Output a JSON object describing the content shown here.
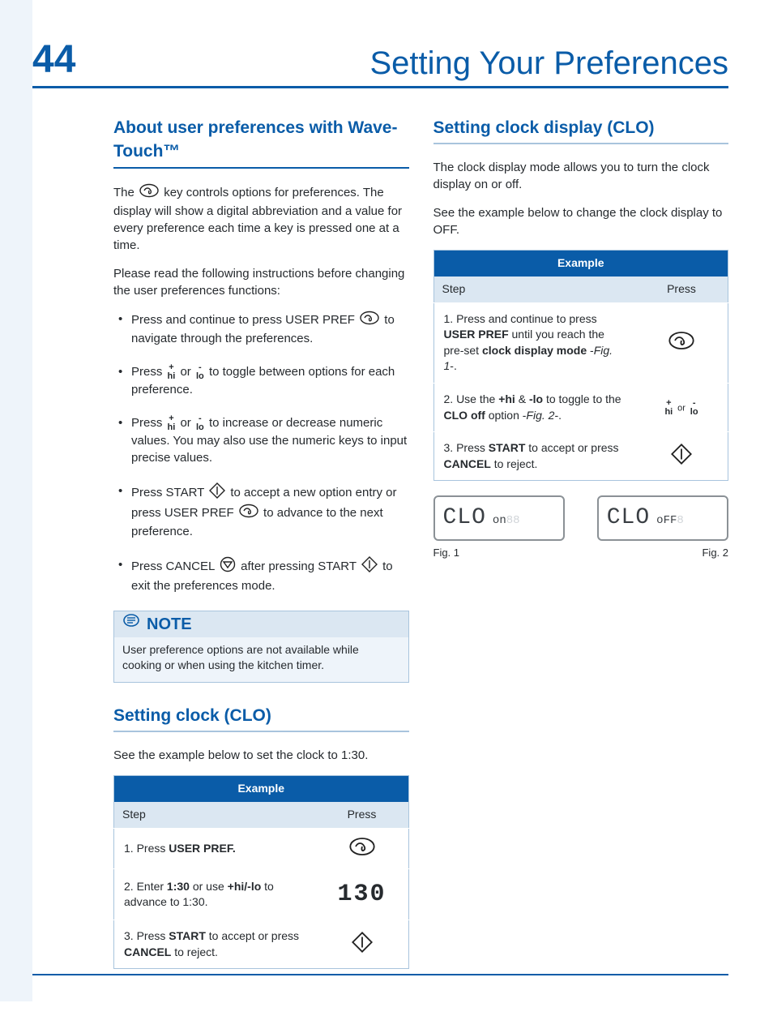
{
  "page_number": "44",
  "title": "Setting Your Preferences",
  "left": {
    "h_about": "About user preferences with Wave-Touch™",
    "p_intro_a": "The ",
    "p_intro_b": " key controls options for preferences. The display will show a digital abbreviation and a value for every preference each time a key is pressed one at a time.",
    "p_readfirst": "Please read the following instructions before changing the user preferences functions:",
    "b1a": "Press and continue to press USER PREF ",
    "b1b": " to navigate through the preferences.",
    "b2a": "Press ",
    "b2b": " or ",
    "b2c": " to toggle between options for each preference.",
    "b3a": "Press ",
    "b3b": " or ",
    "b3c": " to increase or decrease numeric values. You may also use the numeric keys to input precise values.",
    "b4a": "Press START ",
    "b4b": " to accept a new option entry or press USER PREF ",
    "b4c": " to advance to the next preference.",
    "b5a": "Press CANCEL ",
    "b5b": " after pressing START ",
    "b5c": " to exit the preferences mode.",
    "note_title": "NOTE",
    "note_body": "User preference options are not available while cooking or when using the kitchen timer.",
    "h_clock": "Setting clock (CLO)",
    "p_clock": "See the example below to set the clock to 1:30.",
    "tbl_title": "Example",
    "col_step": "Step",
    "col_press": "Press",
    "r1_a": "1. Press ",
    "r1_b": "USER PREF.",
    "r2_a": "2. Enter ",
    "r2_b": "1:30",
    "r2_c": " or use ",
    "r2_d": "+hi/-lo",
    "r2_e": " to advance to 1:30.",
    "r2_press": "130",
    "r3_a": "3. Press ",
    "r3_b": "START",
    "r3_c": " to accept or press ",
    "r3_d": "CANCEL",
    "r3_e": " to reject."
  },
  "right": {
    "h_clockdisp": "Setting clock display (CLO)",
    "p1": "The clock display mode allows you to turn the clock display on or off.",
    "p2": "See the example below to change the clock display to OFF.",
    "tbl_title": "Example",
    "col_step": "Step",
    "col_press": "Press",
    "r1_a": "1. Press and continue to press ",
    "r1_b": "USER PREF",
    "r1_c": " until you reach the pre-set ",
    "r1_d": "clock display mode",
    "r1_e": " -",
    "r1_f": "Fig. 1",
    "r1_g": "-.",
    "r2_a": "2. Use the ",
    "r2_b": "+hi",
    "r2_c": " & ",
    "r2_d": "-lo",
    "r2_e": " to toggle to the ",
    "r2_f": "CLO off",
    "r2_g": " option  -",
    "r2_h": "Fig. 2",
    "r2_i": "-.",
    "r3_a": "3. Press ",
    "r3_b": "START",
    "r3_c": " to accept or press ",
    "r3_d": "CANCEL",
    "r3_e": " to reject.",
    "fig1_big": "CLO",
    "fig1_small": "on",
    "fig1_ghost": "88",
    "fig1_cap": "Fig. 1",
    "fig2_big": "CLO",
    "fig2_small": "oFF",
    "fig2_ghost": "8",
    "fig2_cap": "Fig. 2"
  },
  "glyph": {
    "plus": "+",
    "minus": "-",
    "hi": "hi",
    "lo": "lo",
    "or": "or"
  }
}
